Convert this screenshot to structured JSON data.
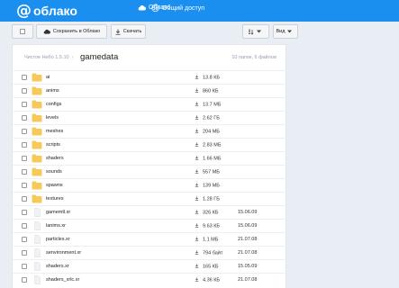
{
  "brand": {
    "logo_symbol": "@",
    "logo_text": "облако"
  },
  "nav": {
    "cloud_label": "Облако",
    "shared_label": "Общий доступ"
  },
  "toolbar": {
    "save_label": "Сохранить в Облако",
    "download_label": "Скачать",
    "view_label": "Вид"
  },
  "breadcrumb": {
    "parent": "Чистое Небо 1.5.10",
    "separator": "›",
    "current": "gamedata"
  },
  "summary": "10 папок, 6 файлов",
  "colors": {
    "topbar": "#1a8ff0",
    "folder": "#f7c95b"
  },
  "items": [
    {
      "type": "folder",
      "name": "ai",
      "size": "13.8 КБ",
      "date": ""
    },
    {
      "type": "folder",
      "name": "anims",
      "size": "860 КБ",
      "date": ""
    },
    {
      "type": "folder",
      "name": "configs",
      "size": "13.7 МБ",
      "date": ""
    },
    {
      "type": "folder",
      "name": "levels",
      "size": "2.62 ГБ",
      "date": ""
    },
    {
      "type": "folder",
      "name": "meshes",
      "size": "204 МБ",
      "date": ""
    },
    {
      "type": "folder",
      "name": "scripts",
      "size": "2.83 МБ",
      "date": ""
    },
    {
      "type": "folder",
      "name": "shaders",
      "size": "1.66 МБ",
      "date": ""
    },
    {
      "type": "folder",
      "name": "sounds",
      "size": "557 МБ",
      "date": ""
    },
    {
      "type": "folder",
      "name": "spawns",
      "size": "139 МБ",
      "date": ""
    },
    {
      "type": "folder",
      "name": "textures",
      "size": "1.28 ГБ",
      "date": ""
    },
    {
      "type": "file",
      "name": "gamemtl.xr",
      "size": "326 КБ",
      "date": "15.06.09"
    },
    {
      "type": "file",
      "name": "lanims.xr",
      "size": "9.63 КБ",
      "date": "15.06.09"
    },
    {
      "type": "file",
      "name": "particles.xr",
      "size": "1.1 МБ",
      "date": "21.07.08"
    },
    {
      "type": "file",
      "name": "senvironment.xr",
      "size": "794 байт",
      "date": "21.07.08"
    },
    {
      "type": "file",
      "name": "shaders.xr",
      "size": "165 КБ",
      "date": "15.05.09"
    },
    {
      "type": "file",
      "name": "shaders_xrlc.xr",
      "size": "4.36 КБ",
      "date": "21.07.08"
    }
  ]
}
